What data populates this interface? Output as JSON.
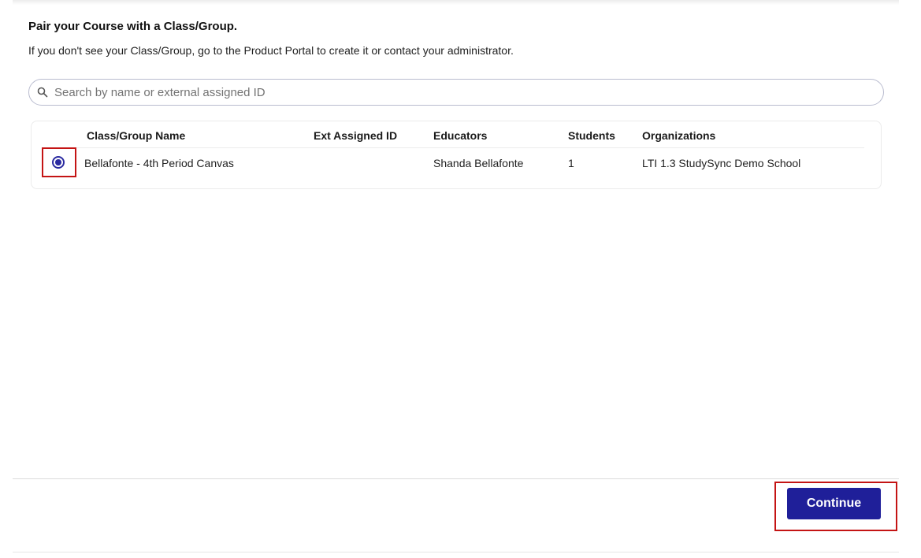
{
  "page": {
    "heading": "Pair your Course with a Class/Group.",
    "subtext": "If you don't see your Class/Group, go to the Product Portal to create it or contact your administrator."
  },
  "search": {
    "placeholder": "Search by name or external assigned ID",
    "value": "",
    "icon": "search-icon"
  },
  "table": {
    "columns": [
      "Class/Group Name",
      "Ext Assigned ID",
      "Educators",
      "Students",
      "Organizations"
    ],
    "rows": [
      {
        "selected": true,
        "name": "Bellafonte - 4th Period Canvas",
        "ext_id": "",
        "educators": "Shanda Bellafonte",
        "students": "1",
        "organizations": "LTI 1.3 StudySync Demo School"
      }
    ]
  },
  "footer": {
    "continue_label": "Continue"
  },
  "colors": {
    "accent": "#1f1f99",
    "highlight": "#c41414"
  }
}
